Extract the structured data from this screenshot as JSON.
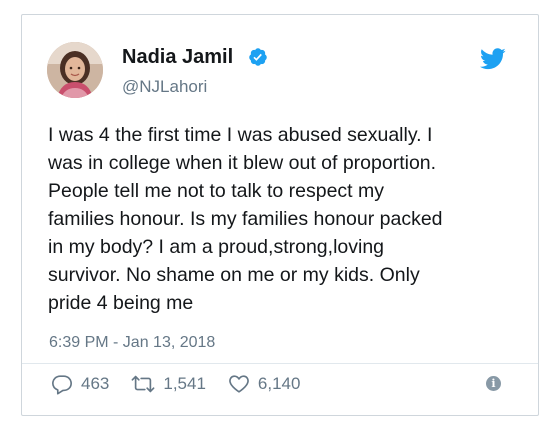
{
  "author": {
    "name": "Nadia Jamil",
    "handle": "@NJLahori",
    "verified": true
  },
  "tweet": {
    "text": "I was 4 the first time I was abused sexually. I\nwas in college when it blew out of proportion.\nPeople tell me not to talk to respect my\nfamilies honour. Is my families honour packed\nin my body? I am a proud,strong,loving\nsurvivor. No shame on me or my kids. Only\npride 4 being me",
    "timestamp": "6:39 PM - Jan 13, 2018"
  },
  "actions": {
    "replies": "463",
    "retweets": "1,541",
    "likes": "6,140"
  },
  "icons": {
    "verified": "verified-badge-icon",
    "brand": "twitter-bird-icon",
    "reply": "reply-icon",
    "retweet": "retweet-icon",
    "like": "heart-icon",
    "info": "info-icon"
  },
  "colors": {
    "brand_blue": "#1da1f2",
    "muted_text": "#657786",
    "primary_text": "#14171a"
  }
}
